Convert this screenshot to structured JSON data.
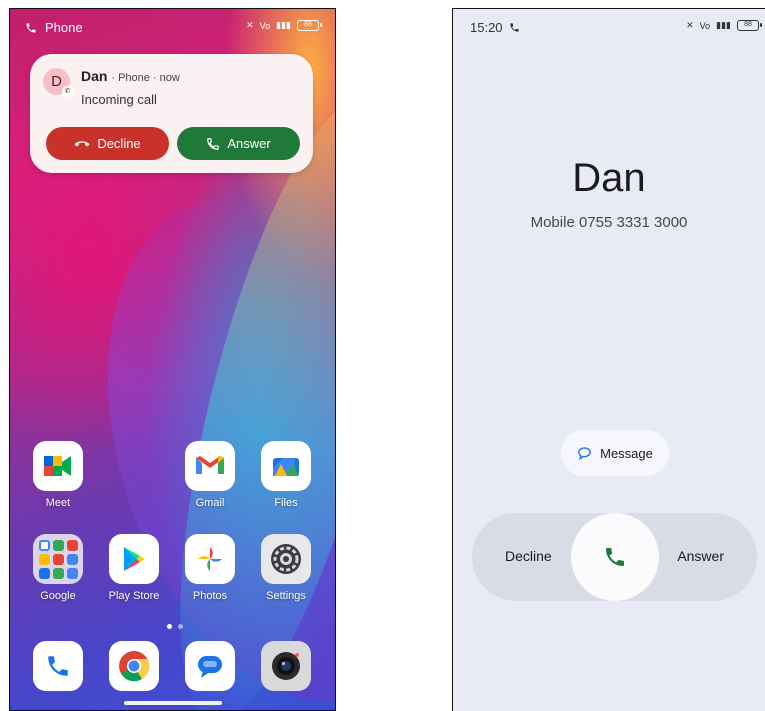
{
  "left_screen": {
    "status_bar": {
      "app_name": "Phone",
      "battery": "88"
    },
    "notification": {
      "avatar_letter": "D",
      "caller": "Dan",
      "meta": "· Phone · now",
      "text": "Incoming call",
      "decline_label": "Decline",
      "answer_label": "Answer",
      "decline_color": "#c8322b",
      "answer_color": "#1f7a3a"
    },
    "apps": [
      {
        "label": "Meet",
        "icon": "meet-icon"
      },
      {
        "label": "Gmail",
        "icon": "gmail-icon"
      },
      {
        "label": "Files",
        "icon": "files-icon"
      },
      {
        "label": "Google",
        "icon": "google-folder-icon"
      },
      {
        "label": "Play Store",
        "icon": "play-store-icon"
      },
      {
        "label": "Photos",
        "icon": "photos-icon"
      },
      {
        "label": "Settings",
        "icon": "settings-icon"
      }
    ],
    "dock": [
      {
        "icon": "phone-app-icon"
      },
      {
        "icon": "chrome-icon"
      },
      {
        "icon": "messages-icon"
      },
      {
        "icon": "camera-icon"
      }
    ]
  },
  "right_screen": {
    "status_bar": {
      "time": "15:20",
      "battery": "88"
    },
    "caller_name": "Dan",
    "caller_number": "Mobile 0755 3331 3000",
    "message_label": "Message",
    "decline_label": "Decline",
    "answer_label": "Answer",
    "accent_green": "#1f7a3a",
    "background": "#e8ebf6"
  }
}
